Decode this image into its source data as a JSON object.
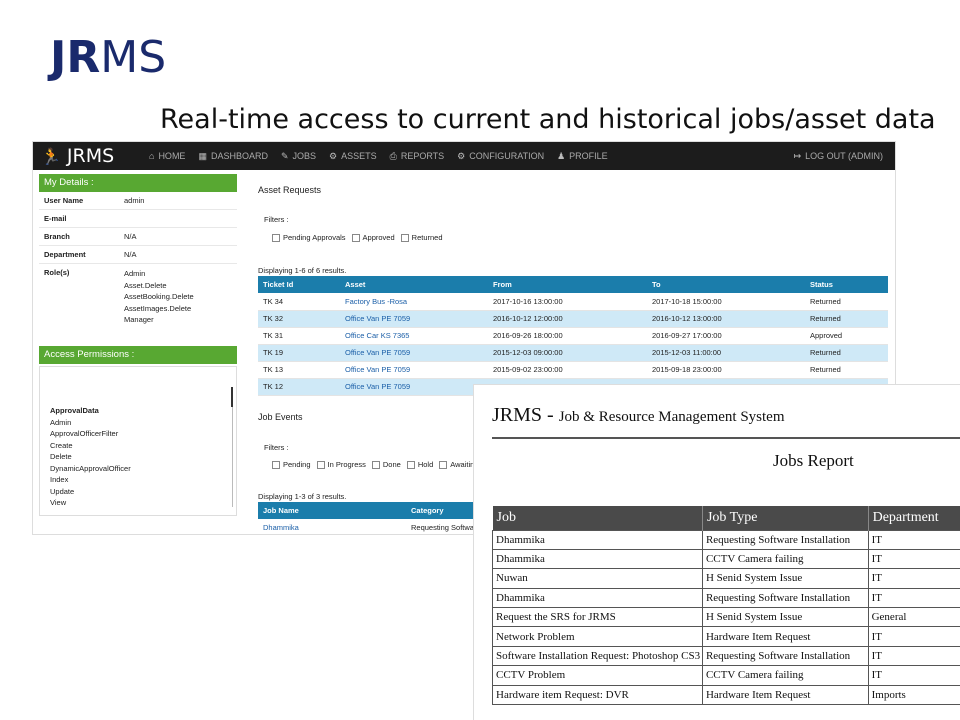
{
  "slide": {
    "logo_bold": "JR",
    "logo_rest": "MS",
    "subtitle": "Real-time access to current and historical jobs/asset data"
  },
  "navbar": {
    "logo": "JRMS",
    "items": [
      {
        "icon": "home-icon",
        "glyph": "⌂",
        "label": "HOME"
      },
      {
        "icon": "dashboard-icon",
        "glyph": "▦",
        "label": "DASHBOARD"
      },
      {
        "icon": "wrench-icon",
        "glyph": "✎",
        "label": "JOBS"
      },
      {
        "icon": "assets-icon",
        "glyph": "⚙",
        "label": "ASSETS"
      },
      {
        "icon": "print-icon",
        "glyph": "⎙",
        "label": "REPORTS"
      },
      {
        "icon": "cogs-icon",
        "glyph": "⚙",
        "label": "CONFIGURATION"
      },
      {
        "icon": "user-icon",
        "glyph": "♟",
        "label": "PROFILE"
      }
    ],
    "logout": "LOG OUT (admin)"
  },
  "my_details": {
    "title": "My Details :",
    "user_name_label": "User Name",
    "user_name": "admin",
    "email_label": "E-mail",
    "branch_label": "Branch",
    "branch": "N/A",
    "department_label": "Department",
    "department": "N/A",
    "roles_label": "Role(s)",
    "roles": [
      "Admin",
      "Asset.Delete",
      "AssetBooking.Delete",
      "AssetImages.Delete",
      "Manager"
    ]
  },
  "access_permissions": {
    "title": "Access Permissions :",
    "group": "ApprovalData",
    "items": [
      "Admin",
      "ApprovalOfficerFilter",
      "Create",
      "Delete",
      "DynamicApprovalOfficer",
      "Index",
      "Update",
      "View"
    ]
  },
  "asset_requests": {
    "title": "Asset Requests",
    "filters_label": "Filters :",
    "filters": [
      "Pending Approvals",
      "Approved",
      "Returned"
    ],
    "summary": "Displaying 1-6 of 6 results.",
    "columns": [
      "Ticket Id",
      "Asset",
      "From",
      "To",
      "Status"
    ],
    "rows": [
      [
        "TK 34",
        "Factory Bus -Rosa",
        "2017-10-16 13:00:00",
        "2017-10-18 15:00:00",
        "Returned"
      ],
      [
        "TK 32",
        "Office Van PE 7059",
        "2016-10-12 12:00:00",
        "2016-10-12 13:00:00",
        "Returned"
      ],
      [
        "TK 31",
        "Office Car KS 7365",
        "2016-09-26 18:00:00",
        "2016-09-27 17:00:00",
        "Approved"
      ],
      [
        "TK 19",
        "Office Van PE 7059",
        "2015-12-03 09:00:00",
        "2015-12-03 11:00:00",
        "Returned"
      ],
      [
        "TK 13",
        "Office Van PE 7059",
        "2015-09-02 23:00:00",
        "2015-09-18 23:00:00",
        "Returned"
      ],
      [
        "TK 12",
        "Office Van PE 7059",
        "",
        "",
        ""
      ]
    ]
  },
  "job_events": {
    "title": "Job Events",
    "filters_label": "Filters :",
    "filters": [
      "Pending",
      "In Progress",
      "Done",
      "Hold",
      "Awaiting"
    ],
    "summary": "Displaying 1-3 of 3 results.",
    "columns": [
      "Job Name",
      "Category"
    ],
    "rows": [
      [
        "Dhammika",
        "Requesting Software"
      ]
    ]
  },
  "report": {
    "title": "JRMS - ",
    "title_sub": "Job & Resource Management System",
    "heading": "Jobs Report",
    "columns": [
      "Job",
      "Job Type",
      "Department"
    ],
    "rows": [
      [
        "Dhammika",
        "Requesting Software Installation",
        "IT"
      ],
      [
        "Dhammika",
        "CCTV Camera failing",
        "IT"
      ],
      [
        "Nuwan",
        "H Senid System Issue",
        "IT"
      ],
      [
        "Dhammika",
        "Requesting Software Installation",
        "IT"
      ],
      [
        "Request the SRS for JRMS",
        "H Senid System Issue",
        "General"
      ],
      [
        "Network Problem",
        "Hardware Item Request",
        "IT"
      ],
      [
        "Software Installation Request: Photoshop CS3",
        "Requesting Software Installation",
        "IT"
      ],
      [
        "CCTV Problem",
        "CCTV Camera failing",
        "IT"
      ],
      [
        "Hardware item Request: DVR",
        "Hardware Item Request",
        "Imports"
      ]
    ]
  }
}
